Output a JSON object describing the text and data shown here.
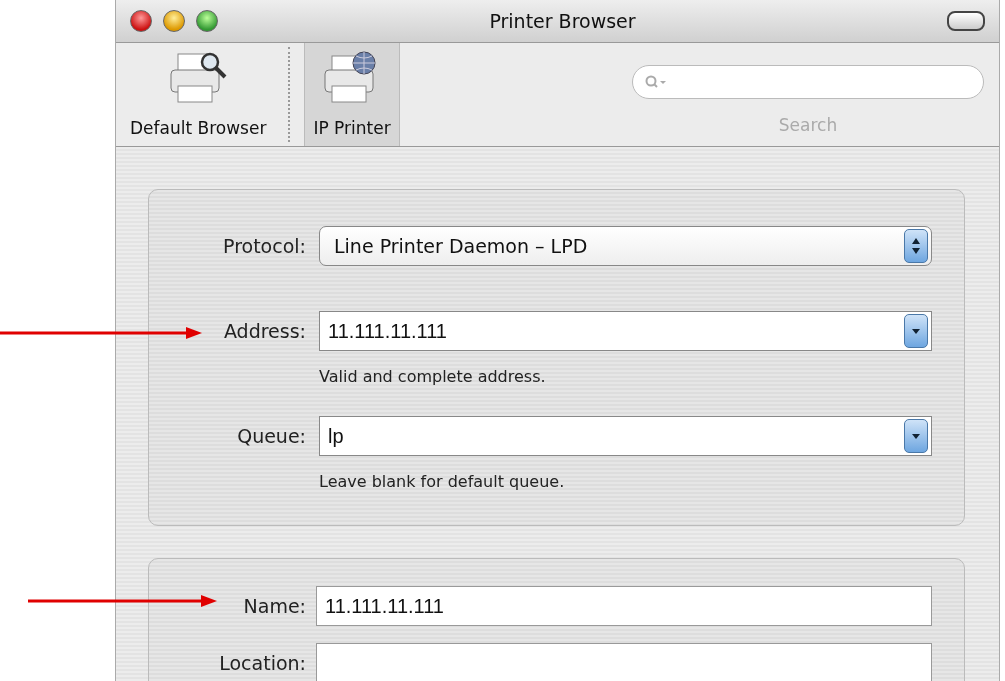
{
  "window": {
    "title": "Printer Browser"
  },
  "toolbar": {
    "items": [
      {
        "kind": "browse",
        "label": "Default Browser",
        "selected": false
      },
      {
        "kind": "ip",
        "label": "IP Printer",
        "selected": true
      }
    ],
    "search": {
      "label": "Search"
    }
  },
  "connection": {
    "fields": [
      {
        "kind": "popup",
        "label": "Protocol:",
        "value": "Line Printer Daemon – LPD"
      },
      {
        "kind": "combo",
        "label": "Address:",
        "value": "11.111.11.111",
        "hint": "Valid and complete address."
      },
      {
        "kind": "combo",
        "label": "Queue:",
        "value": "lp",
        "hint": "Leave blank for default queue."
      }
    ]
  },
  "printer": {
    "fields": [
      {
        "label": "Name:",
        "value": "11.111.11.111"
      },
      {
        "label": "Location:"
      }
    ]
  }
}
